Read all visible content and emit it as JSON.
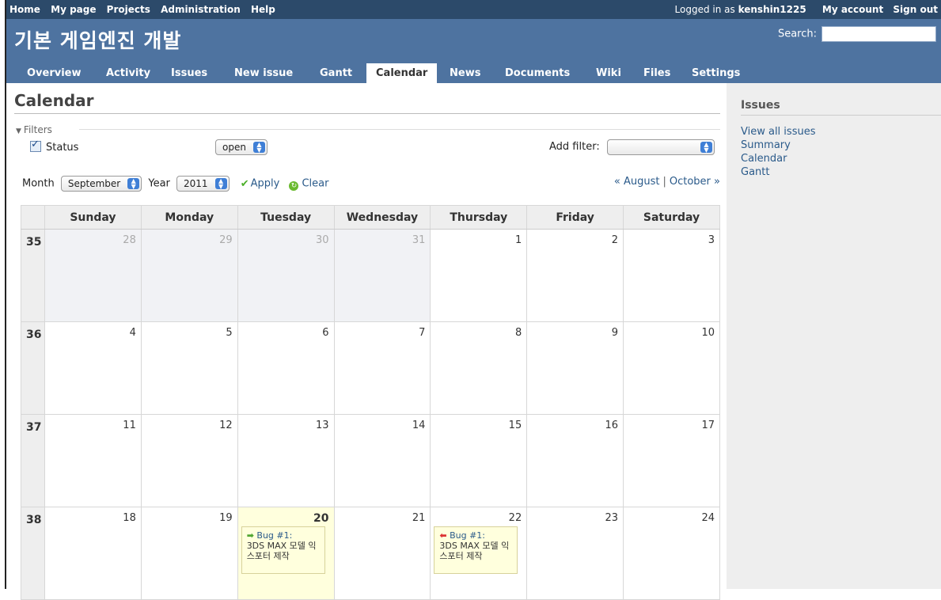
{
  "top_menu": {
    "left": [
      "Home",
      "My page",
      "Projects",
      "Administration",
      "Help"
    ],
    "logged_prefix": "Logged in as",
    "user": "kenshin1225",
    "my_account": "My account",
    "sign_out": "Sign out"
  },
  "header": {
    "title": "기본 게임엔진 개발",
    "search_label": "Search:"
  },
  "tabs": [
    "Overview",
    "Activity",
    "Issues",
    "New issue",
    "Gantt",
    "Calendar",
    "News",
    "Documents",
    "Wiki",
    "Files",
    "Settings"
  ],
  "selected_tab": "Calendar",
  "page_title": "Calendar",
  "filters": {
    "legend": "Filters",
    "status_label": "Status",
    "status_value": "open",
    "add_filter_label": "Add filter:",
    "add_filter_value": ""
  },
  "month_row": {
    "month_label": "Month",
    "month_value": "September",
    "year_label": "Year",
    "year_value": "2011",
    "apply": "Apply",
    "clear": "Clear",
    "prev": "« August",
    "next": "October »"
  },
  "calendar": {
    "weekdays": [
      "Sunday",
      "Monday",
      "Tuesday",
      "Wednesday",
      "Thursday",
      "Friday",
      "Saturday"
    ],
    "weeks": [
      {
        "num": "35",
        "days": [
          "28",
          "29",
          "30",
          "31",
          "1",
          "2",
          "3"
        ]
      },
      {
        "num": "36",
        "days": [
          "4",
          "5",
          "6",
          "7",
          "8",
          "9",
          "10"
        ]
      },
      {
        "num": "37",
        "days": [
          "11",
          "12",
          "13",
          "14",
          "15",
          "16",
          "17"
        ]
      },
      {
        "num": "38",
        "days": [
          "18",
          "19",
          "20",
          "21",
          "22",
          "23",
          "24"
        ]
      }
    ],
    "issue_start": {
      "title": "Bug #1:",
      "desc": "3DS MAX 모델 익스포터 제작"
    },
    "issue_end": {
      "title": "Bug #1:",
      "desc": "3DS MAX 모델 익스포터 제작"
    }
  },
  "sidebar": {
    "heading": "Issues",
    "links": [
      "View all issues",
      "Summary",
      "Calendar",
      "Gantt"
    ]
  }
}
